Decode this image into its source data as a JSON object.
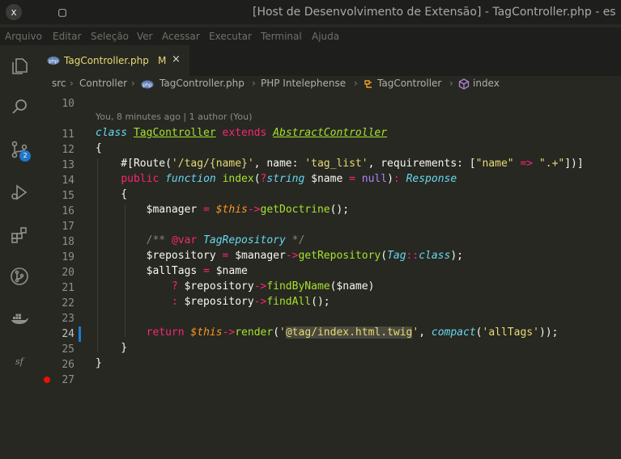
{
  "window": {
    "title": "[Host de Desenvolvimento de Extensão] - TagController.php - es",
    "close_icon": "x",
    "restore_icon": "▢"
  },
  "menu": [
    "Arquivo",
    "Editar",
    "Seleção",
    "Ver",
    "Acessar",
    "Executar",
    "Terminal",
    "Ajuda"
  ],
  "activity_bar": {
    "scm_badge": "2"
  },
  "tab": {
    "label": "TagController.php",
    "modified": "M",
    "close": "×"
  },
  "breadcrumbs": [
    "src",
    "Controller",
    "TagController.php",
    "PHP Intelephense",
    "TagController",
    "index"
  ],
  "codelens": "You, 8 minutes ago | 1 author (You)",
  "line_numbers": [
    "10",
    "11",
    "12",
    "13",
    "14",
    "15",
    "16",
    "17",
    "18",
    "19",
    "20",
    "21",
    "22",
    "23",
    "24",
    "25",
    "26",
    "27"
  ]
}
